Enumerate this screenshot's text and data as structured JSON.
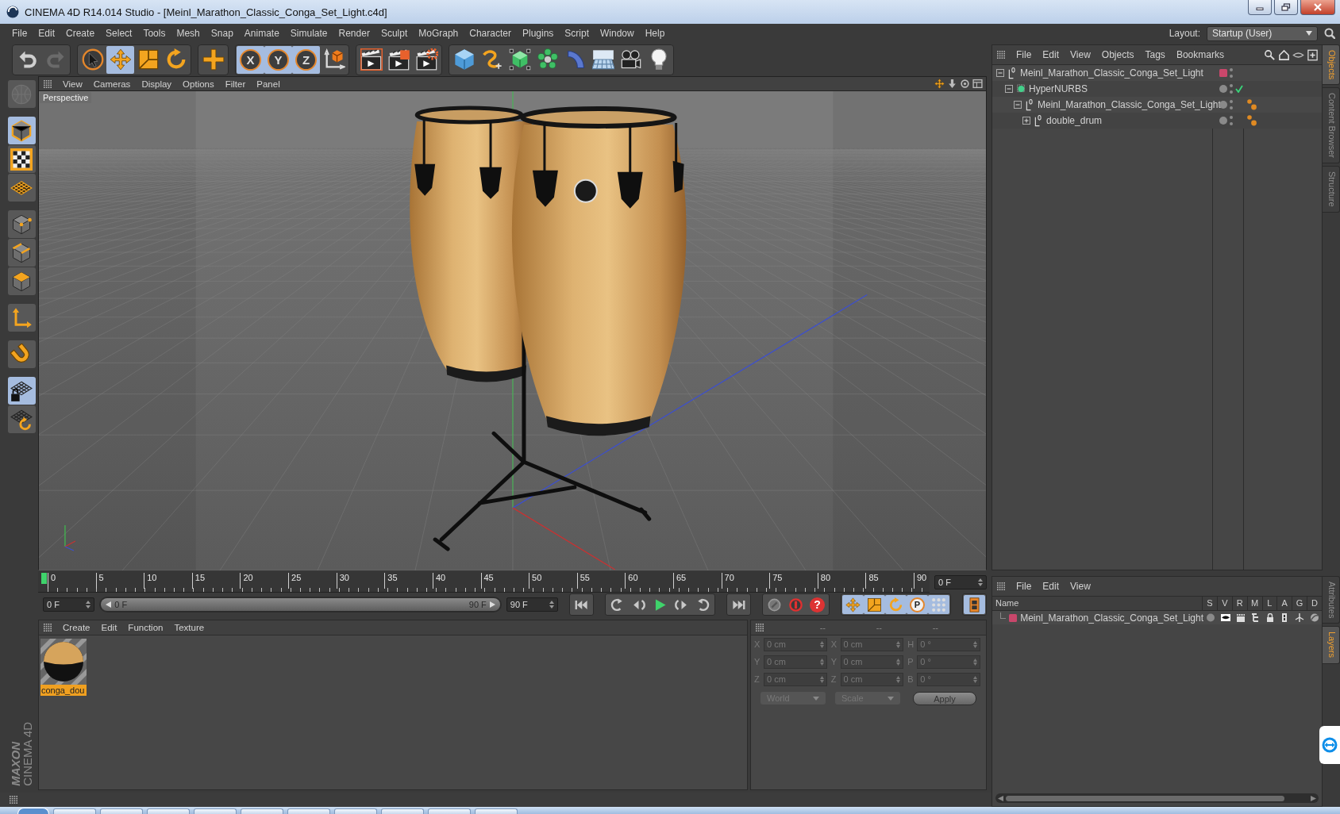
{
  "window": {
    "title": "CINEMA 4D R14.014 Studio - [Meinl_Marathon_Classic_Conga_Set_Light.c4d]"
  },
  "menu_bar": [
    "File",
    "Edit",
    "Create",
    "Select",
    "Tools",
    "Mesh",
    "Snap",
    "Animate",
    "Simulate",
    "Render",
    "Sculpt",
    "MoGraph",
    "Character",
    "Plugins",
    "Script",
    "Window",
    "Help"
  ],
  "layout": {
    "label": "Layout:",
    "value": "Startup (User)"
  },
  "toolbar": {
    "history": [
      {
        "disabled": false
      },
      {
        "disabled": true
      }
    ],
    "tools": [
      {
        "selected": false
      },
      {
        "selected": true
      },
      {
        "selected": false
      },
      {
        "selected": false
      }
    ],
    "axis_locks": [
      {
        "label": "X",
        "on": true
      },
      {
        "label": "Y",
        "on": true
      },
      {
        "label": "Z",
        "on": true
      }
    ]
  },
  "mode_palette": [
    {
      "selected": false,
      "disabled": true
    },
    {
      "selected": true,
      "disabled": false
    },
    {
      "selected": false,
      "disabled": false
    },
    {
      "selected": false,
      "disabled": false
    },
    {
      "selected": false,
      "disabled": false
    },
    {
      "selected": false,
      "disabled": false
    },
    {
      "selected": false,
      "disabled": false
    },
    {
      "selected": false,
      "disabled": false
    },
    {
      "selected": false,
      "disabled": false
    },
    {
      "selected": true,
      "disabled": false
    },
    {
      "selected": false,
      "disabled": false
    }
  ],
  "viewport": {
    "menu": [
      "View",
      "Cameras",
      "Display",
      "Options",
      "Filter",
      "Panel"
    ],
    "camera": "Perspective"
  },
  "timeline": {
    "ticks": [
      "0",
      "5",
      "10",
      "15",
      "20",
      "25",
      "30",
      "35",
      "40",
      "45",
      "50",
      "55",
      "60",
      "65",
      "70",
      "75",
      "80",
      "85",
      "90"
    ],
    "playhead": {
      "level": 0
    },
    "frame": "0 F",
    "start": "0 F",
    "range": {
      "start": "0 F",
      "end": "90 F",
      "level": 1
    },
    "end": "90 F",
    "help": "?",
    "key_buttons": [
      {
        "selected": true
      },
      {
        "selected": true
      },
      {
        "selected": true
      },
      {
        "label": "P",
        "selected": true
      },
      {
        "selected": true
      }
    ],
    "timeline_button": {
      "selected": true
    }
  },
  "materials": {
    "menu": [
      "Create",
      "Edit",
      "Function",
      "Texture"
    ],
    "items": [
      {
        "name": "conga_dou",
        "selected": true
      }
    ]
  },
  "coordinates": {
    "disabled": true,
    "headers": [
      "--",
      "--",
      "--"
    ],
    "rows": [
      {
        "labels": [
          "X",
          "X",
          "H"
        ],
        "values": [
          "0 cm",
          "0 cm",
          "0 °"
        ]
      },
      {
        "labels": [
          "Y",
          "Y",
          "P"
        ],
        "values": [
          "0 cm",
          "0 cm",
          "0 °"
        ]
      },
      {
        "labels": [
          "Z",
          "Z",
          "B"
        ],
        "values": [
          "0 cm",
          "0 cm",
          "0 °"
        ]
      }
    ],
    "space": "World",
    "mode": "Scale",
    "apply": "Apply"
  },
  "brand": {
    "maker": "MAXON",
    "product": "CINEMA 4D"
  },
  "object_manager": {
    "menu": [
      "File",
      "Edit",
      "View",
      "Objects",
      "Tags",
      "Bookmarks"
    ],
    "objects": [
      {
        "name": "Meinl_Marathon_Classic_Conga_Set_Light",
        "kind": "null",
        "expanded": true,
        "color": "#c9476b",
        "children": [
          {
            "name": "HyperNURBS",
            "kind": "nurbs",
            "expanded": true,
            "enabled": true,
            "children": [
              {
                "name": "Meinl_Marathon_Classic_Conga_Set_Light",
                "kind": "null",
                "expanded": true,
                "tags": [
                  {
                    "kind": "texture"
                  }
                ],
                "children": [
                  {
                    "name": "double_drum",
                    "kind": "null",
                    "expanded": false,
                    "tags": [
                      {
                        "kind": "texture"
                      }
                    ]
                  }
                ]
              }
            ]
          }
        ]
      }
    ]
  },
  "layer_manager": {
    "menu": [
      "File",
      "Edit",
      "View"
    ],
    "columns": [
      "Name",
      "S",
      "V",
      "R",
      "M",
      "L",
      "A",
      "G",
      "D"
    ],
    "layers": [
      {
        "name": "Meinl_Marathon_Classic_Conga_Set_Light",
        "color": "#c9476b"
      }
    ]
  },
  "side_tabs": {
    "upper": [
      {
        "label": "Objects",
        "selected": true
      },
      {
        "label": "Content Browser",
        "selected": false
      },
      {
        "label": "Structure",
        "selected": false
      }
    ],
    "lower": [
      {
        "label": "Attributes",
        "selected": false
      },
      {
        "label": "Layers",
        "selected": true
      }
    ]
  }
}
